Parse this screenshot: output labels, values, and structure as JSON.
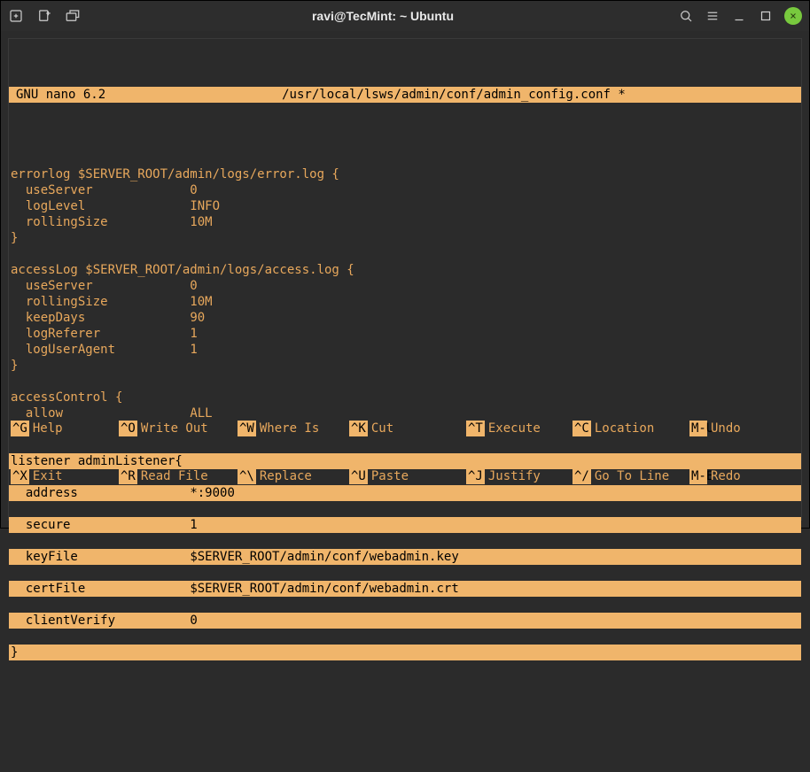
{
  "titlebar": {
    "title": "ravi@TecMint: ~ Ubuntu"
  },
  "nano": {
    "version": "GNU nano 6.2",
    "filepath": "/usr/local/lsws/admin/conf/admin_config.conf *"
  },
  "config": {
    "errorlog": {
      "header": "errorlog $SERVER_ROOT/admin/logs/error.log {",
      "entries": [
        {
          "key": "useServer",
          "value": "0"
        },
        {
          "key": "logLevel",
          "value": "INFO"
        },
        {
          "key": "rollingSize",
          "value": "10M"
        }
      ],
      "close": "}"
    },
    "accessLog": {
      "header": "accessLog $SERVER_ROOT/admin/logs/access.log {",
      "entries": [
        {
          "key": "useServer",
          "value": "0"
        },
        {
          "key": "rollingSize",
          "value": "10M"
        },
        {
          "key": "keepDays",
          "value": "90"
        },
        {
          "key": "logReferer",
          "value": "1"
        },
        {
          "key": "logUserAgent",
          "value": "1"
        }
      ],
      "close": "}"
    },
    "accessControl": {
      "header": "accessControl {",
      "entries": [
        {
          "key": "allow",
          "value": "ALL"
        }
      ],
      "close": "}"
    },
    "listener": {
      "header": "listener adminListener{",
      "entries": [
        {
          "key": "address",
          "value": "*:9000"
        },
        {
          "key": "secure",
          "value": "1"
        },
        {
          "key": "keyFile",
          "value": "$SERVER_ROOT/admin/conf/webadmin.key"
        },
        {
          "key": "certFile",
          "value": "$SERVER_ROOT/admin/conf/webadmin.crt"
        },
        {
          "key": "clientVerify",
          "value": "0"
        }
      ],
      "close": "}"
    }
  },
  "shortcuts": {
    "row1": [
      {
        "key": "^G",
        "label": "Help"
      },
      {
        "key": "^O",
        "label": "Write Out"
      },
      {
        "key": "^W",
        "label": "Where Is"
      },
      {
        "key": "^K",
        "label": "Cut"
      },
      {
        "key": "^T",
        "label": "Execute"
      },
      {
        "key": "^C",
        "label": "Location"
      },
      {
        "key": "M-U",
        "label": "Undo"
      }
    ],
    "row2": [
      {
        "key": "^X",
        "label": "Exit"
      },
      {
        "key": "^R",
        "label": "Read File"
      },
      {
        "key": "^\\",
        "label": "Replace"
      },
      {
        "key": "^U",
        "label": "Paste"
      },
      {
        "key": "^J",
        "label": "Justify"
      },
      {
        "key": "^/",
        "label": "Go To Line"
      },
      {
        "key": "M-E",
        "label": "Redo"
      }
    ]
  }
}
